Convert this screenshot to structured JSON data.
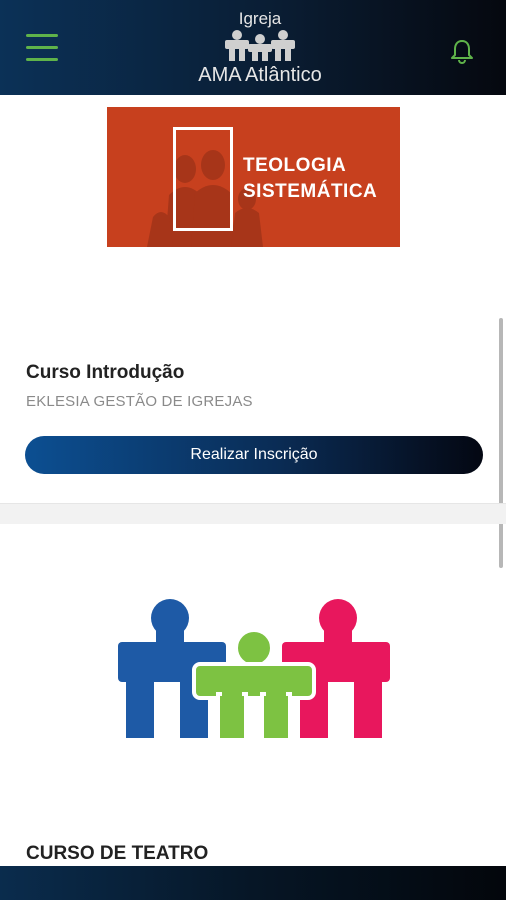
{
  "header": {
    "logo_top": "Igreja",
    "logo_bottom": "AMA Atlântico",
    "menu_icon": "hamburger-menu-icon",
    "notification_icon": "bell-icon",
    "colors": {
      "gradient_start": "#0b3157",
      "gradient_end": "#05080f",
      "accent": "#5fb34a"
    }
  },
  "courses": [
    {
      "banner": {
        "line1": "TEOLOGIA",
        "line2": "SISTEMÁTICA",
        "color": "#c7401e"
      },
      "title": "Curso Introdução",
      "subtitle": "EKLESIA GESTÃO DE IGREJAS",
      "button_label": "Realizar Inscrição"
    },
    {
      "image": "puzzle-people-logo",
      "title": "CURSO DE TEATRO",
      "colors": {
        "blue": "#1e5aa6",
        "green": "#7dc242",
        "pink": "#e8175d"
      }
    }
  ]
}
